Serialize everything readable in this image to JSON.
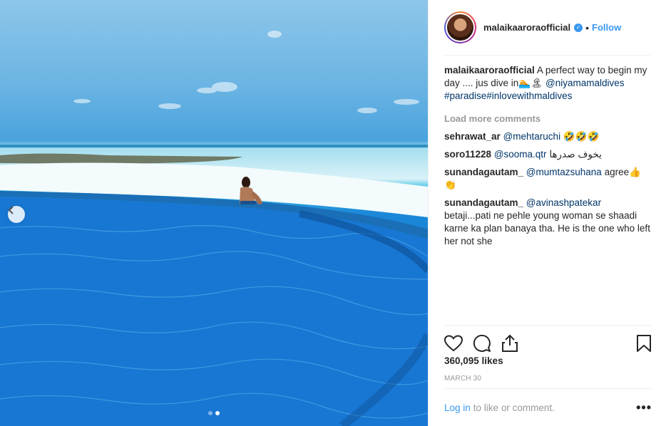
{
  "post": {
    "username": "malaikaaroraofficial",
    "follow_label": "Follow",
    "separator": "•",
    "verified_glyph": "✓",
    "caption": {
      "username": "malaikaaroraofficial",
      "text": "A perfect way to begin my day .... jus dive in🏊🏝",
      "mention": "@niyamamaldives",
      "hashtags": "#paradise#inlovewithmaldives"
    },
    "load_more_label": "Load more comments",
    "comments": [
      {
        "username": "sehrawat_ar",
        "mention": "@mehtaruchi",
        "text": "🤣🤣🤣"
      },
      {
        "username": "soro11228",
        "mention": "@sooma.qtr",
        "text": "يخوف صدرها"
      },
      {
        "username": "sunandagautam_",
        "mention": "@mumtazsuhana",
        "text": "agree👍👏"
      },
      {
        "username": "sunandagautam_",
        "mention": "@avinashpatekar",
        "text": "betaji...pati ne pehle young woman se shaadi karne ka plan banaya tha. He is the one who left her not she"
      }
    ],
    "likes": "360,095 likes",
    "date": "MARCH 30",
    "login_link": "Log in",
    "login_text": "to like or comment.",
    "more_label": "•••"
  },
  "icons": {
    "carousel_prev": "chevron-left-icon",
    "like": "heart-icon",
    "comment": "comment-icon",
    "share": "share-icon",
    "save": "bookmark-icon"
  },
  "colors": {
    "accent": "#3897f0",
    "link": "#003569",
    "muted": "#999999",
    "text": "#262626"
  }
}
